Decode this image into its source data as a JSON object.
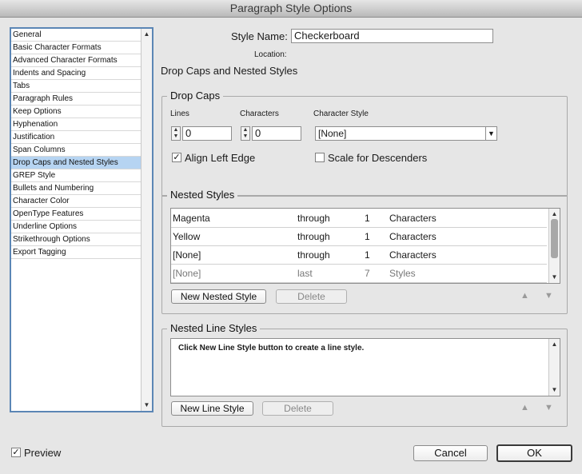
{
  "window": {
    "title": "Paragraph Style Options"
  },
  "sidebar": {
    "items": [
      "General",
      "Basic Character Formats",
      "Advanced Character Formats",
      "Indents and Spacing",
      "Tabs",
      "Paragraph Rules",
      "Keep Options",
      "Hyphenation",
      "Justification",
      "Span Columns",
      "Drop Caps and Nested Styles",
      "GREP Style",
      "Bullets and Numbering",
      "Character Color",
      "OpenType Features",
      "Underline Options",
      "Strikethrough Options",
      "Export Tagging"
    ],
    "selected_index": 10
  },
  "style_name": {
    "label": "Style Name:",
    "value": "Checkerboard"
  },
  "location": {
    "label": "Location:"
  },
  "section_title": "Drop Caps and Nested Styles",
  "drop_caps": {
    "title": "Drop Caps",
    "lines_label": "Lines",
    "lines_value": "0",
    "characters_label": "Characters",
    "characters_value": "0",
    "char_style_label": "Character Style",
    "char_style_value": "[None]",
    "align_left_edge": {
      "label": "Align Left Edge",
      "checked": true
    },
    "scale_descenders": {
      "label": "Scale for Descenders",
      "checked": false
    }
  },
  "nested_styles": {
    "title": "Nested Styles",
    "rows": [
      {
        "style": "Magenta",
        "mode": "through",
        "count": "1",
        "unit": "Characters"
      },
      {
        "style": "Yellow",
        "mode": "through",
        "count": "1",
        "unit": "Characters"
      },
      {
        "style": "[None]",
        "mode": "through",
        "count": "1",
        "unit": "Characters"
      },
      {
        "style": "[None]",
        "mode": "last",
        "count": "7",
        "unit": "Styles"
      }
    ],
    "new_button": "New Nested Style",
    "delete_button": "Delete"
  },
  "nested_line_styles": {
    "title": "Nested Line Styles",
    "hint": "Click New Line Style button to create a line style.",
    "new_button": "New Line Style",
    "delete_button": "Delete"
  },
  "preview": {
    "label": "Preview",
    "checked": true
  },
  "footer": {
    "cancel": "Cancel",
    "ok": "OK"
  },
  "icons": {
    "check": "✓",
    "up_arrow": "▲",
    "down_arrow": "▼"
  }
}
